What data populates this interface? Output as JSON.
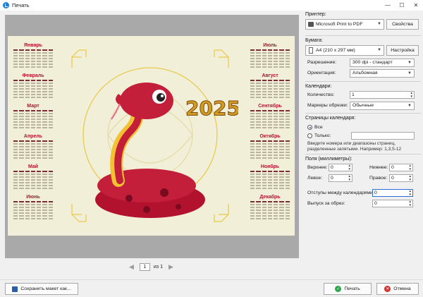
{
  "window": {
    "title": "Печать",
    "minimize": "—",
    "maximize": "☐",
    "close": "✕"
  },
  "preview": {
    "months_left": [
      "Январь",
      "Февраль",
      "Март",
      "Апрель",
      "Май",
      "Июнь"
    ],
    "months_right": [
      "Июль",
      "Август",
      "Сентябрь",
      "Октябрь",
      "Ноябрь",
      "Декабрь"
    ],
    "year": "2025"
  },
  "pagination": {
    "current": "1",
    "of_label": "из 1",
    "prev_icon": "arrow-left",
    "next_icon": "arrow-right"
  },
  "printer": {
    "label": "Принтер:",
    "value": "Microsoft Print to PDF",
    "properties_button": "Свойства"
  },
  "paper": {
    "label": "Бумага:",
    "value": "A4 (210 x 297 мм)",
    "setup_button": "Настройка"
  },
  "resolution": {
    "label": "Разрешение:",
    "value": "300 dpi - стандарт"
  },
  "orientation": {
    "label": "Ориентация:",
    "value": "Альбомная"
  },
  "calendars": {
    "label": "Календари:",
    "count_label": "Количество:",
    "count_value": "1",
    "crop_label": "Маркеры обрезки:",
    "crop_value": "Обычные"
  },
  "pages": {
    "label": "Страницы календаря:",
    "all_label": "Все",
    "only_label": "Только:",
    "only_value": "",
    "hint": "Введите номера или диапазоны страниц, разделенные запятыми. Например: 1,3,5-12"
  },
  "margins": {
    "label": "Поля (миллиметры):",
    "top_label": "Верхнее:",
    "top_value": "0",
    "bottom_label": "Нижнее:",
    "bottom_value": "0",
    "left_label": "Левое:",
    "left_value": "0",
    "right_label": "Правое:",
    "right_value": "0",
    "gap_label": "Отступы между календарями:",
    "gap_value": "0",
    "bleed_label": "Выпуск за обрез:",
    "bleed_value": "0"
  },
  "buttons": {
    "save_layout": "Сохранить макет как...",
    "print": "Печать",
    "cancel": "Отмена"
  },
  "colors": {
    "accent": "#b3122e",
    "print_icon": "#2aa84a",
    "cancel_icon": "#d9302b"
  }
}
